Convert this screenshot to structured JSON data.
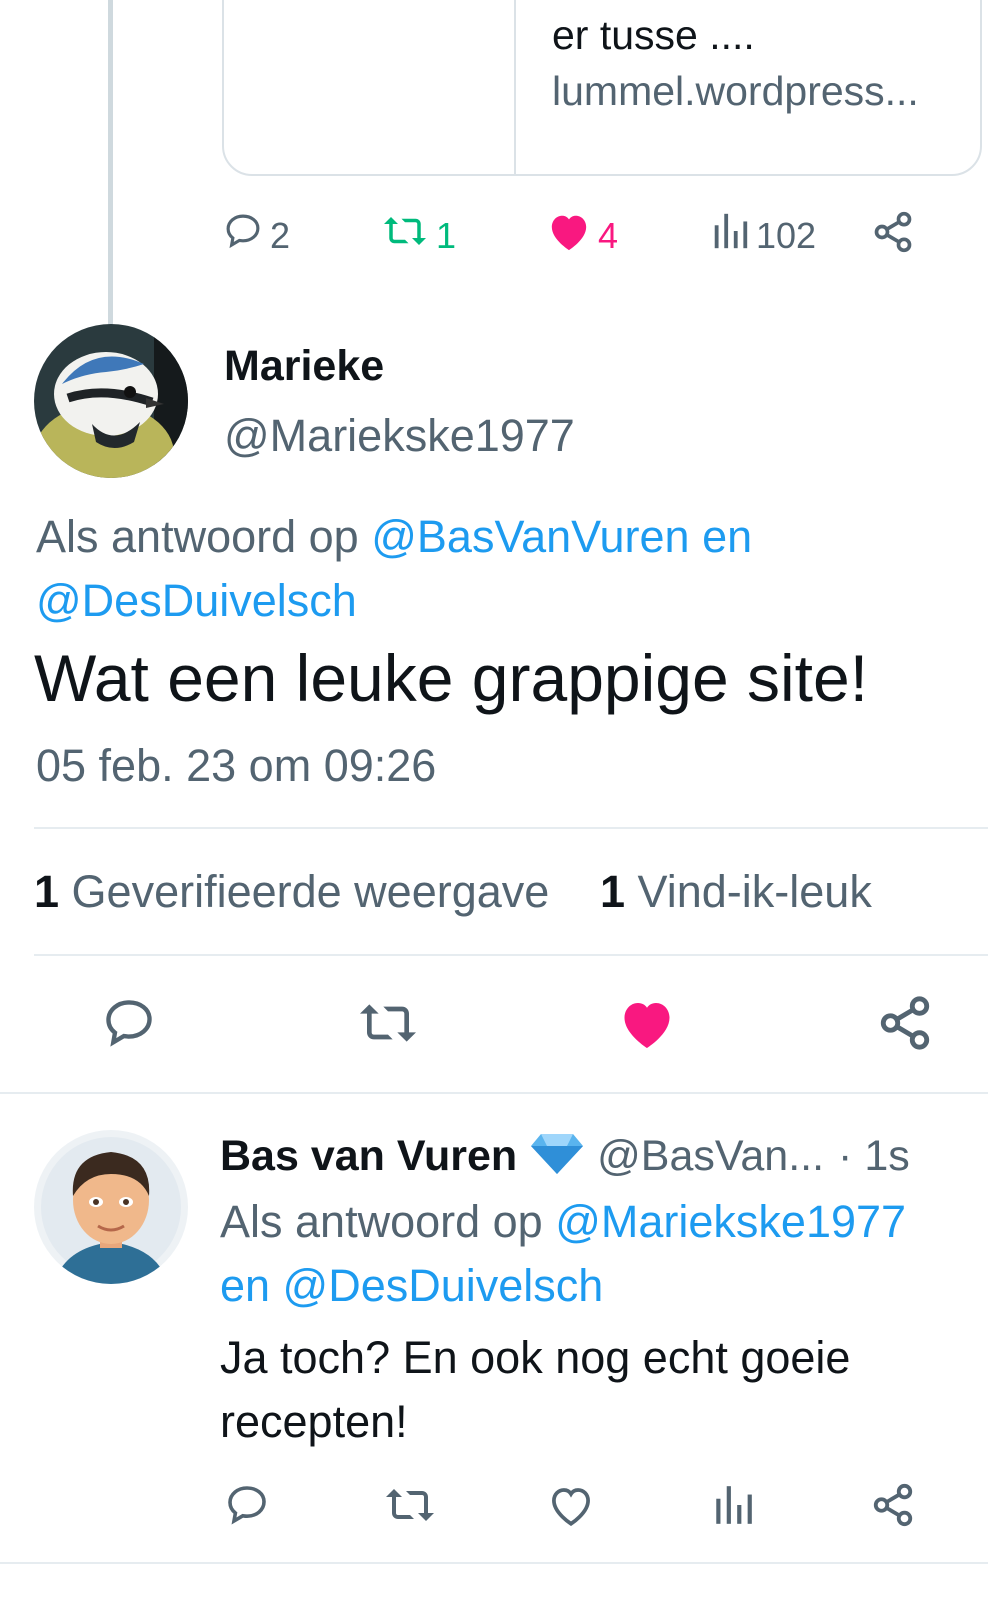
{
  "prev_tweet": {
    "card": {
      "text_line": "er tusse ....",
      "domain": "lummel.wordpress..."
    },
    "actions": {
      "replies": "2",
      "retweets": "1",
      "likes": "4",
      "views": "102"
    }
  },
  "main_tweet": {
    "author": {
      "name": "Marieke",
      "handle": "@Mariekske1977"
    },
    "reply_prefix": "Als antwoord op",
    "reply_mention_1": "@BasVanVuren en",
    "reply_mention_2": "@DesDuivelsch",
    "text": "Wat een leuke grappige site!",
    "timestamp": "05 feb. 23 om 09:26",
    "stats": {
      "views_count": "1",
      "views_label": "Geverifieerde weergave",
      "likes_count": "1",
      "likes_label": "Vind-ik-leuk"
    }
  },
  "reply_tweet": {
    "author": {
      "name": "Bas van Vuren",
      "handle": "@BasVan...",
      "time": "· 1s"
    },
    "reply_prefix": "Als antwoord op",
    "reply_mention_1": "@Mariekske1977",
    "reply_mention_2": "en @DesDuivelsch",
    "text_line1": "Ja toch? En ook nog echt goeie",
    "text_line2": "recepten!"
  },
  "colors": {
    "accent": "#1d9bf0",
    "like": "#f91880",
    "retweet": "#00ba7c",
    "secondary": "#536471"
  }
}
